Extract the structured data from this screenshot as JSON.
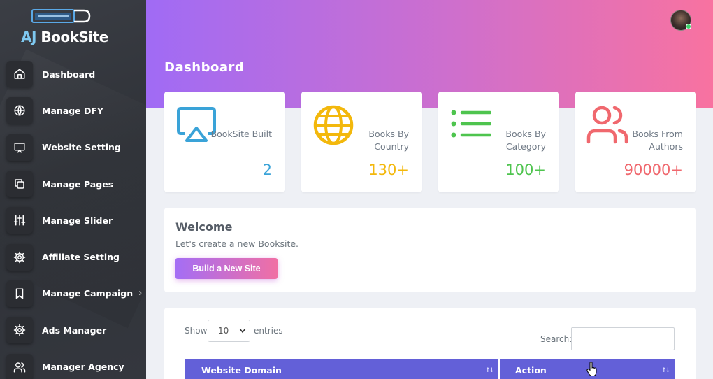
{
  "brand": {
    "prefix": "AJ",
    "name": "BookSite"
  },
  "sidebar": {
    "items": [
      {
        "label": "Dashboard",
        "icon": "home-icon"
      },
      {
        "label": "Manage DFY",
        "icon": "globe-icon"
      },
      {
        "label": "Website Setting",
        "icon": "monitor-icon"
      },
      {
        "label": "Manage Pages",
        "icon": "copy-icon"
      },
      {
        "label": "Manage Slider",
        "icon": "sliders-icon"
      },
      {
        "label": "Affiliate Setting",
        "icon": "gear-icon"
      },
      {
        "label": "Manage Campaign",
        "icon": "bookmark-icon",
        "chevron": "›"
      },
      {
        "label": "Ads Manager",
        "icon": "gear-icon"
      },
      {
        "label": "Manager Agency",
        "icon": "users-icon"
      }
    ]
  },
  "header": {
    "title": "Dashboard"
  },
  "stats": [
    {
      "label": "BookSite Built",
      "value": "2",
      "color": "#3aa3d8",
      "icon": "airplay-icon"
    },
    {
      "label": "Books By Country",
      "value": "130+",
      "color": "#f3b80c",
      "icon": "globe-icon"
    },
    {
      "label": "Books By Category",
      "value": "100+",
      "color": "#4ec44e",
      "icon": "list-icon"
    },
    {
      "label": "Books From Authors",
      "value": "90000+",
      "color": "#f0686e",
      "icon": "users-icon"
    }
  ],
  "welcome": {
    "title": "Welcome",
    "subtitle": "Let's create a new Booksite.",
    "button": "Build a New Site"
  },
  "table": {
    "show_label": "Show",
    "page_size": "10",
    "entries_label": "entries",
    "search_label": "Search:",
    "search_value": "",
    "columns": [
      "Website Domain",
      "Action"
    ],
    "sort_glyph": "↑↓"
  },
  "colors": {
    "accent_start": "#a06bf5",
    "accent_end": "#f872a0",
    "table_header": "#6360d8"
  }
}
